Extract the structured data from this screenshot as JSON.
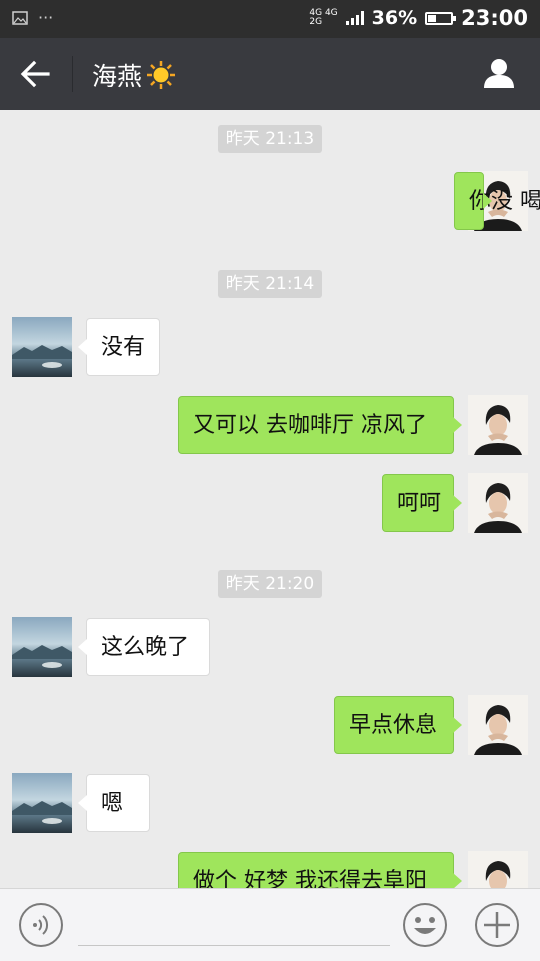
{
  "status_bar": {
    "network_top": "4G 4G",
    "network_bottom": "2G",
    "battery_percent": "36%",
    "battery_level": 0.36,
    "time": "23:00",
    "icons": [
      "image-icon",
      "more-icon",
      "signal-icon",
      "battery-icon"
    ]
  },
  "header": {
    "contact_name": "海燕",
    "contact_emoji": "☀️",
    "icons": [
      "back-arrow-icon",
      "person-icon"
    ]
  },
  "messages": [
    {
      "type": "time",
      "text": "昨天 21:13"
    },
    {
      "type": "msg",
      "from": "me",
      "text": "你没 喝两杯吗"
    },
    {
      "type": "time",
      "text": "昨天 21:14"
    },
    {
      "type": "msg",
      "from": "other",
      "text": "没有"
    },
    {
      "type": "msg",
      "from": "me",
      "text": "又可以 去咖啡厅 凉风了"
    },
    {
      "type": "msg",
      "from": "me",
      "text": "呵呵"
    },
    {
      "type": "time",
      "text": "昨天 21:20"
    },
    {
      "type": "msg",
      "from": "other",
      "text": "这么晚了"
    },
    {
      "type": "msg",
      "from": "me",
      "text": "早点休息"
    },
    {
      "type": "msg",
      "from": "other",
      "text": "嗯"
    },
    {
      "type": "msg",
      "from": "me",
      "text": "做个 好梦 我还得去阜阳"
    }
  ],
  "input_bar": {
    "icons": [
      "voice-icon",
      "emoji-icon",
      "plus-icon"
    ]
  },
  "colors": {
    "titlebar": "#393a3f",
    "statusbar": "#2e2e2e",
    "chat_bg": "#ebebeb",
    "my_bubble": "#9fe55c",
    "their_bubble": "#ffffff",
    "timestamp_bg": "#d4d4d4"
  }
}
